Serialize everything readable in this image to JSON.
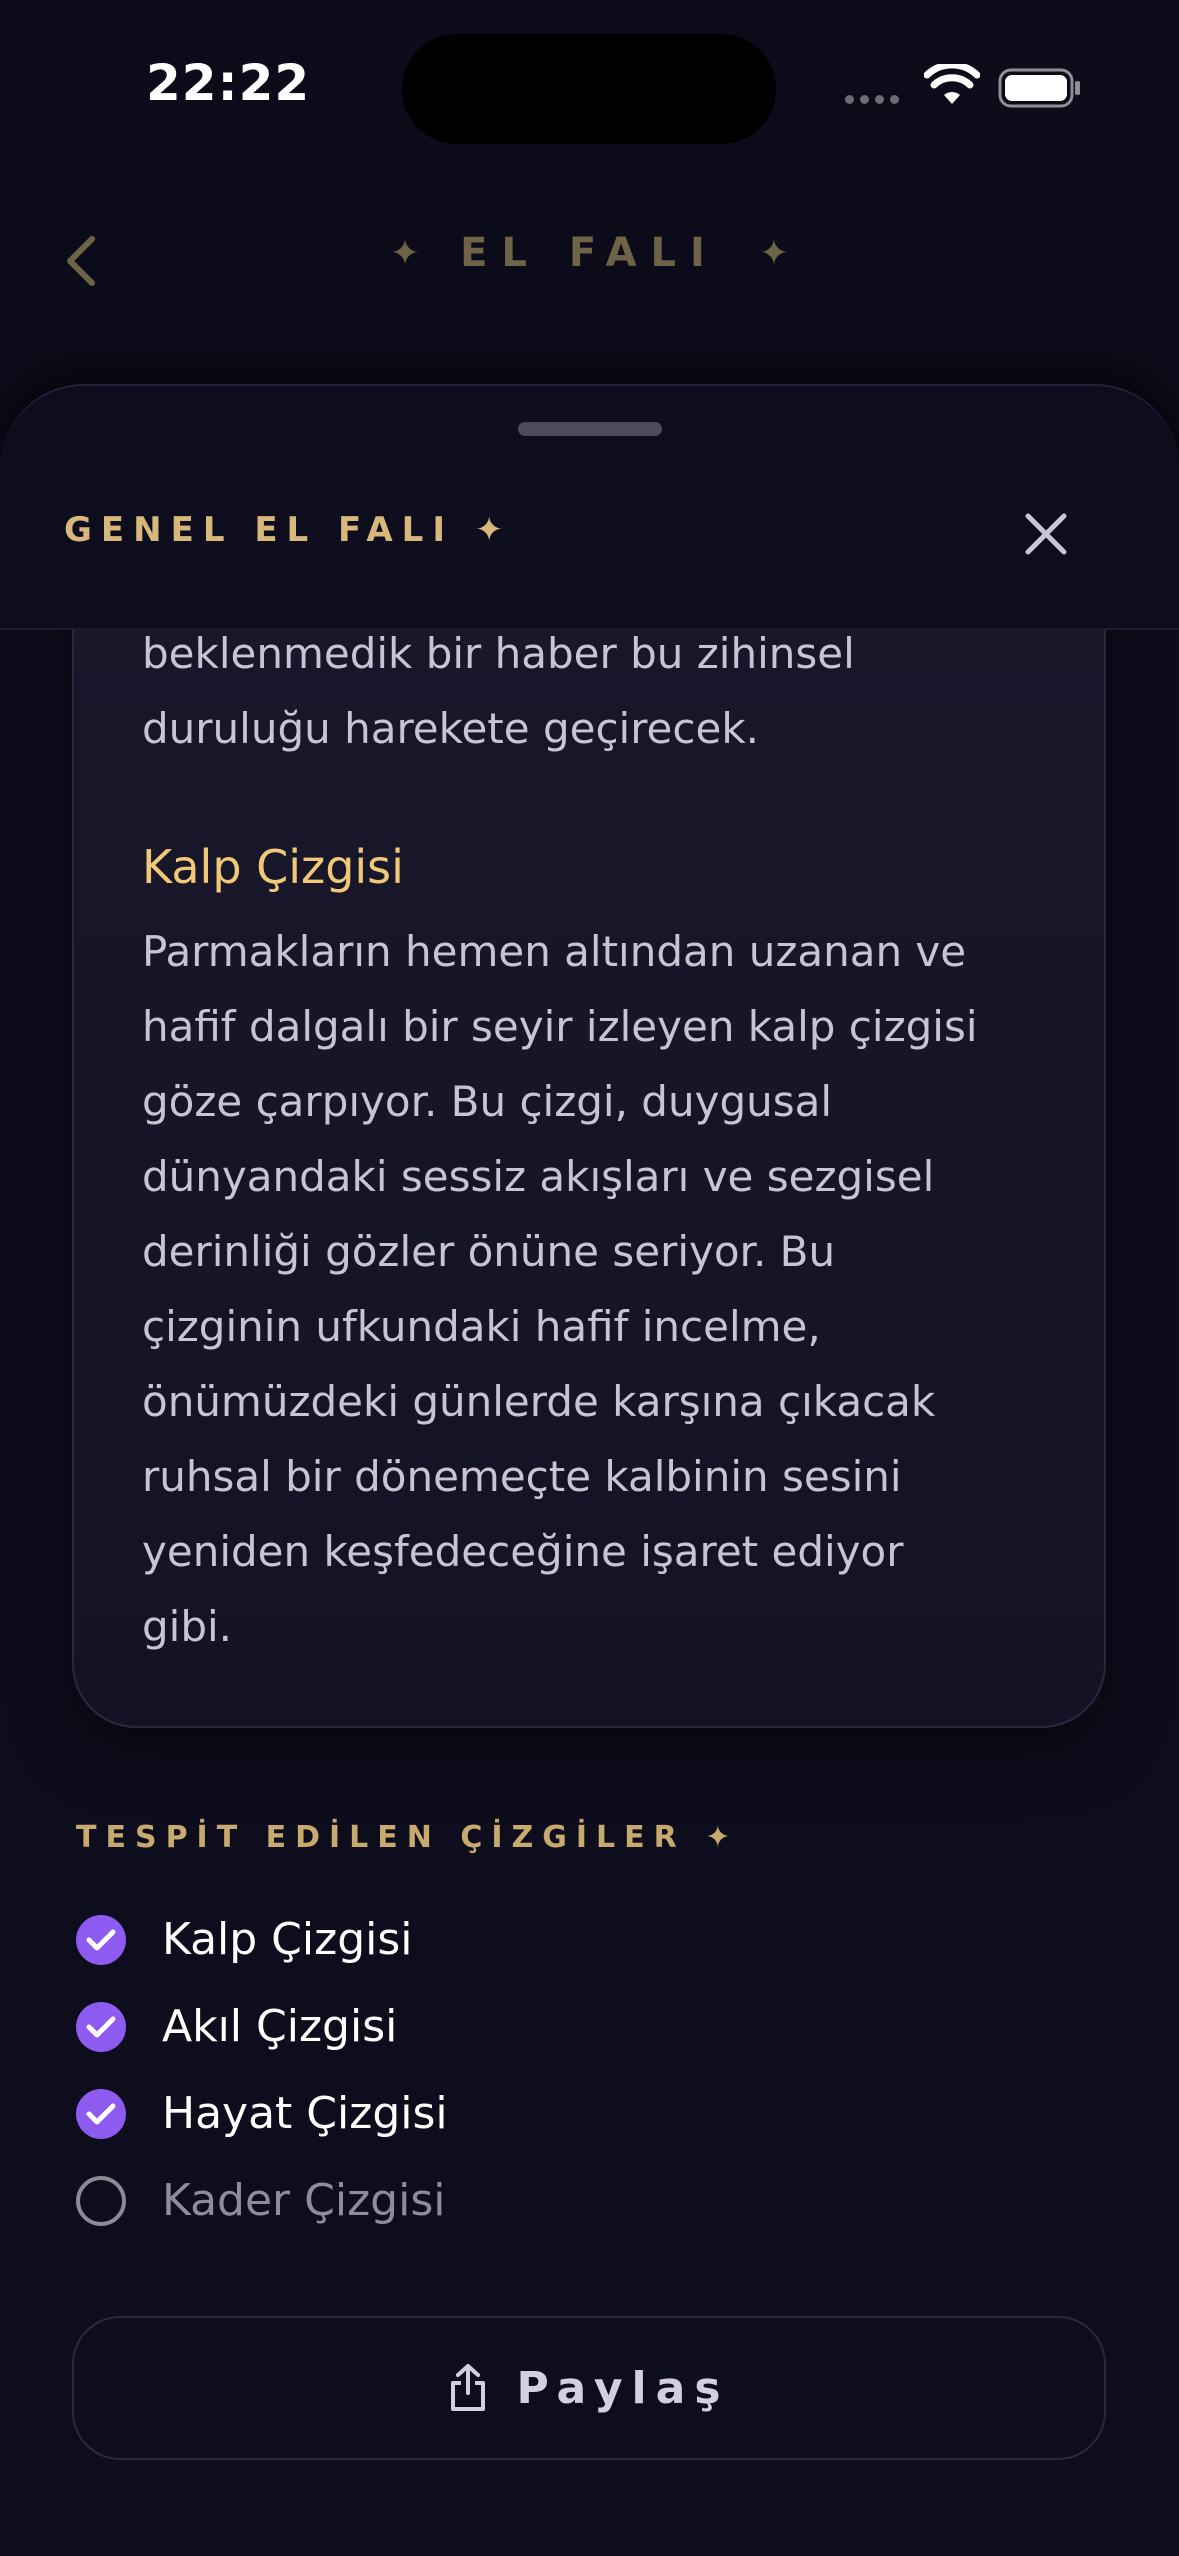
{
  "status_bar": {
    "time": "22:22"
  },
  "header": {
    "title": "EL FALI",
    "spark": "✦"
  },
  "sheet": {
    "title": "GENEL EL FALI ✦",
    "reading": {
      "intro_lines": [
        "beklenmedik bir haber bu zihinsel",
        "duruluğu harekete geçirecek."
      ],
      "heading": "Kalp Çizgisi",
      "body_lines": [
        "Parmakların hemen altından uzanan ve",
        "hafif dalgalı bir seyir izleyen kalp çizgisi",
        "göze çarpıyor. Bu çizgi, duygusal",
        "dünyandaki sessiz akışları ve sezgisel",
        "derinliği gözler önüne seriyor. Bu",
        "çizginin ufkundaki hafif incelme,",
        "önümüzdeki günlerde karşına çıkacak",
        "ruhsal bir dönemeçte kalbinin sesini",
        "yeniden keşfedeceğine işaret ediyor",
        "gibi."
      ]
    },
    "detected": {
      "title": "TESPİT EDİLEN ÇİZGİLER ✦",
      "items": [
        {
          "label": "Kalp Çizgisi",
          "checked": true
        },
        {
          "label": "Akıl Çizgisi",
          "checked": true
        },
        {
          "label": "Hayat Çizgisi",
          "checked": true
        },
        {
          "label": "Kader Çizgisi",
          "checked": false
        }
      ]
    },
    "share_label": "Paylaş"
  },
  "colors": {
    "accent": "#8d5bf0",
    "gold": "#d8b87a",
    "background": "#0c0b19"
  }
}
